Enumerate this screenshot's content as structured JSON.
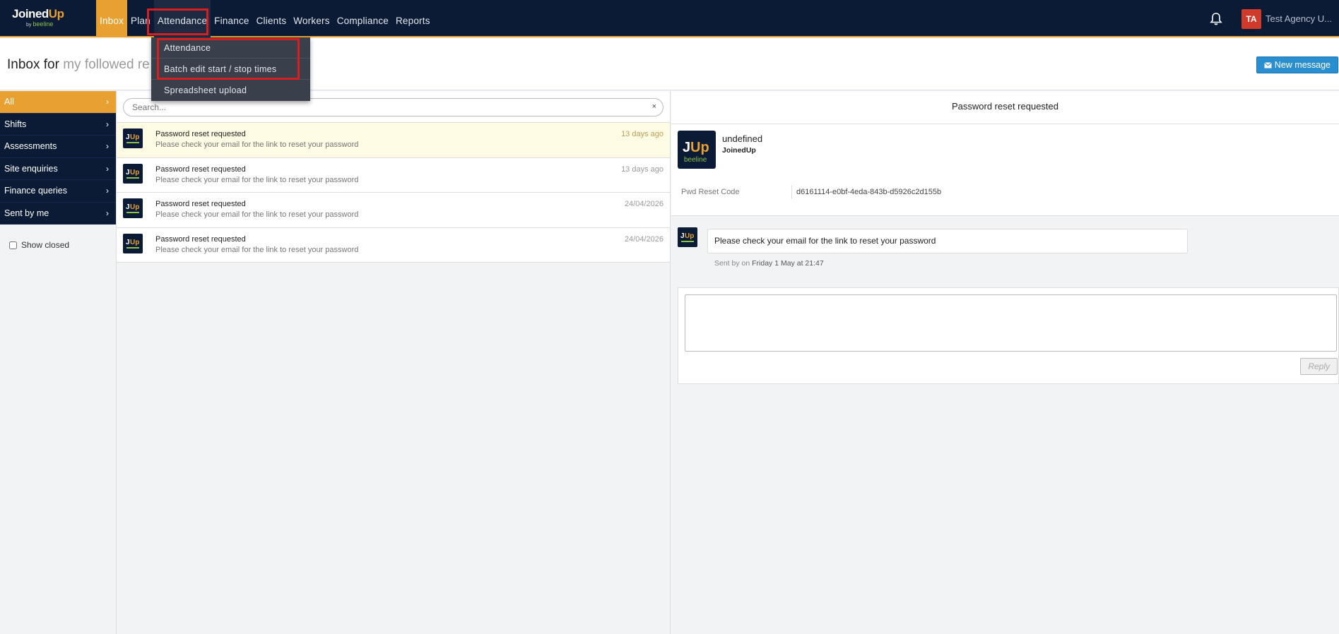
{
  "logo": {
    "brand_a": "Joined",
    "brand_b": "Up",
    "sub_for": "by ",
    "sub_brand": "beeline"
  },
  "nav": {
    "inbox": "Inbox",
    "plan": "Plan",
    "attendance": "Attendance",
    "finance": "Finance",
    "clients": "Clients",
    "workers": "Workers",
    "compliance": "Compliance",
    "reports": "Reports"
  },
  "user": {
    "initials": "TA",
    "name": "Test Agency U..."
  },
  "dropdown": {
    "items": [
      "Attendance",
      "Batch edit start / stop times",
      "Spreadsheet upload"
    ]
  },
  "header": {
    "title_prefix": "Inbox for",
    "title_filter": "my followed re",
    "new_message": "New message"
  },
  "sidebar": {
    "items": [
      "All",
      "Shifts",
      "Assessments",
      "Site enquiries",
      "Finance queries",
      "Sent by me"
    ],
    "show_closed": "Show closed"
  },
  "search": {
    "placeholder": "Search...",
    "clear": "×"
  },
  "messages": [
    {
      "title": "Password reset requested",
      "preview": "Please check your email for the link to reset your password",
      "date": "13 days ago"
    },
    {
      "title": "Password reset requested",
      "preview": "Please check your email for the link to reset your password",
      "date": "13 days ago"
    },
    {
      "title": "Password reset requested",
      "preview": "Please check your email for the link to reset your password",
      "date": "24/04/2026"
    },
    {
      "title": "Password reset requested",
      "preview": "Please check your email for the link to reset your password",
      "date": "24/04/2026"
    }
  ],
  "detail": {
    "title": "Password reset requested",
    "sender_name": "undefined",
    "sender_org": "JoinedUp",
    "meta_label": "Pwd Reset Code",
    "meta_value": "d6161114-e0bf-4eda-843b-d5926c2d155b",
    "message": "Please check your email for the link to reset your password",
    "sent_prefix": "Sent by on",
    "sent_when": "Friday 1 May at 21:47",
    "reply": "Reply"
  },
  "colors": {
    "navy": "#0b1a35",
    "orange": "#e8a030",
    "highlight_red": "#d81e1e",
    "blue_button": "#2a8fd0"
  }
}
